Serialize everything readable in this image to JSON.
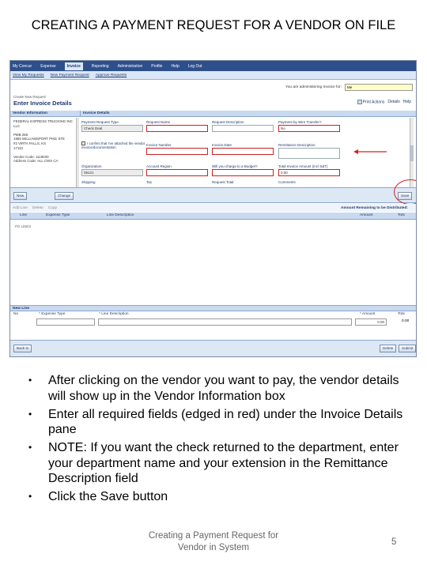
{
  "slide": {
    "title": "CREATING A PAYMENT REQUEST FOR A VENDOR ON FILE",
    "bullets": [
      "After clicking on the vendor you want to pay, the vendor details will show up in the Vendor Information box",
      "Enter all required fields (edged in red) under the Invoice Details pane",
      "NOTE: If you want the check returned to the department, enter your department name and your extension  in the Remittance Description field",
      "Click the Save button"
    ],
    "footer": "Creating a Payment Request for Vendor in System",
    "page_number": "5"
  },
  "app": {
    "top_nav": [
      "My Concur",
      "Expense",
      "Invoice",
      "Reporting",
      "Administration",
      "Profile",
      "Help",
      "Log Out"
    ],
    "active_nav": "Invoice",
    "sub_nav": [
      "View My Requests",
      "New Payment Request",
      "Approve Requests"
    ],
    "admin_label": "You are administering Invoice for:",
    "admin_value": "Me",
    "breadcrumb": "Create New Request",
    "page_title": "Enter Invoice Details",
    "actions": [
      "Print Actions",
      "Details",
      "Help"
    ],
    "vendor_header": "Vendor Information",
    "invoice_header": "Invoice Details",
    "vendor_lines": [
      "FEDERAL EXPRESS TRUCKING INC",
      "LLC",
      "",
      "PMB 268",
      "1956 WILLIAMSPORT PIKE STE",
      "#2 VIRTA FALLS, KS",
      "17110",
      "",
      "Vendor Code: 1119030",
      "Address Code: ALL CWS CA"
    ],
    "fields": {
      "payment_request_type": {
        "label": "Payment Request Type",
        "value": "Check Deal"
      },
      "request_name": {
        "label": "Request Name",
        "value": ""
      },
      "request_description": {
        "label": "Request Description",
        "value": ""
      },
      "pickup_by_transfer": {
        "label": "Payment by Wire Transfer?",
        "value": "No"
      },
      "invoice_number": {
        "label": "Invoice Number",
        "value": ""
      },
      "invoice_date": {
        "label": "Invoice Date",
        "value": ""
      },
      "remittance_description": {
        "label": "Remittance Description",
        "value": ""
      },
      "organization": {
        "label": "Organization",
        "value": "09121"
      },
      "account_region": {
        "label": "Account Region",
        "value": ""
      },
      "charge_question": {
        "label": "Will you charge to a Budget?",
        "value": ""
      },
      "total_invoice_amount": {
        "label": "Total Invoice Amount (incl S&T)",
        "value": "0.00"
      },
      "shipping": {
        "label": "Shipping",
        "value": ""
      },
      "tax": {
        "label": "Tax",
        "value": ""
      },
      "request_total": {
        "label": "Request Total",
        "value": ""
      },
      "comments": {
        "label": "Comments",
        "value": ""
      }
    },
    "checkbox_label": "I confirm that I've attached the vendor invoice/documentation",
    "buttons": {
      "new": "New",
      "change": "Change",
      "save": "Save",
      "back": "Back to",
      "delete": "Delete",
      "submit": "Submit"
    },
    "toolbar_items": [
      "Add Line",
      "Delete",
      "Copy"
    ],
    "toolbar_right": "Amount Remaining to be Distributed:",
    "grid_headers": [
      "Line",
      "Expense Type",
      "Line Description",
      "Amount",
      "Tots"
    ],
    "po_cell": "PO LINES",
    "new_line_header": "New Line",
    "new_line_cols": [
      "No",
      "* Expense Type",
      "* Line Description",
      "* Amount",
      "Tots"
    ],
    "new_line_amount": "0.00",
    "new_line_total": "0.00"
  }
}
